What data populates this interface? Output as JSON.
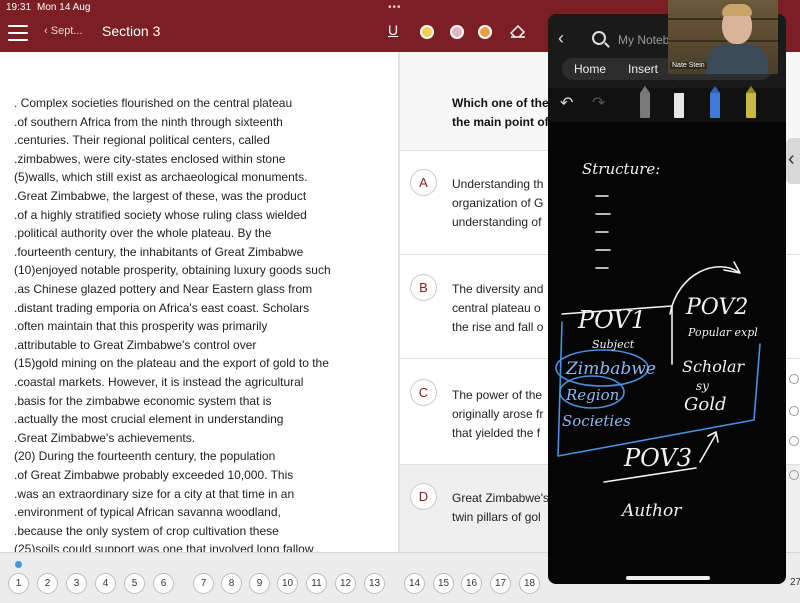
{
  "status": {
    "time": "19:31",
    "date": "Mon 14 Aug",
    "dots": "•••"
  },
  "header": {
    "back_label": "Sept...",
    "title": "Section 3",
    "underline_tool": "U"
  },
  "passage": {
    "lines": [
      ".     Complex societies flourished on the central plateau",
      ".of southern Africa from the ninth through sixteenth",
      ".centuries. Their regional political centers, called",
      ".zimbabwes, were city-states enclosed within stone",
      "(5)walls, which still exist as archaeological monuments.",
      ".Great Zimbabwe, the largest of these, was the product",
      ".of a highly stratified society whose ruling class wielded",
      ".political authority over the whole plateau. By the",
      ".fourteenth century, the inhabitants of Great Zimbabwe",
      "(10)enjoyed notable prosperity, obtaining luxury goods such",
      ".as Chinese glazed pottery and Near Eastern glass from",
      ".distant trading emporia on Africa's east coast. Scholars",
      ".often maintain that this prosperity was primarily",
      ".attributable to Great Zimbabwe's control over",
      "(15)gold mining on the plateau and the export of gold to the",
      ".coastal markets. However, it is instead the agricultural",
      ".basis for the zimbabwe economic system that is",
      ".actually the most crucial element in understanding",
      ".Great Zimbabwe's achievements.",
      "(20)      During the fourteenth century, the population",
      ".of Great Zimbabwe probably exceeded 10,000. This",
      ".was an extraordinary size for a city at that time in an",
      ".environment of typical African savanna woodland,",
      ".because the only system of crop cultivation these",
      "(25)soils could support was one that involved long fallow"
    ]
  },
  "question": {
    "prompt_lines": [
      "Which one of the",
      "the main point of"
    ],
    "choices": [
      {
        "letter": "A",
        "lines": [
          "Understanding th",
          "organization of G",
          "understanding of"
        ]
      },
      {
        "letter": "B",
        "lines": [
          "The diversity and",
          "central plateau o",
          "the rise and fall o"
        ]
      },
      {
        "letter": "C",
        "lines": [
          "The power of the",
          "originally arose fr",
          "that yielded the f"
        ]
      },
      {
        "letter": "D",
        "lines": [
          "Great Zimbabwe's",
          "twin pillars of gol"
        ]
      }
    ]
  },
  "nav": {
    "numbers": [
      "1",
      "2",
      "3",
      "4",
      "5",
      "6",
      "7",
      "8",
      "9",
      "10",
      "11",
      "12",
      "13",
      "14",
      "15",
      "16",
      "17",
      "18"
    ],
    "overflow": "27"
  },
  "notebook": {
    "title": "My Notebo",
    "tabs": {
      "home": "Home",
      "insert": "Insert"
    },
    "handwriting": {
      "structure": "Structure:",
      "pov1": "POV1",
      "pov2": "POV2",
      "pov3": "POV3",
      "subject": "Subject",
      "zimbabwe": "Zimbabwe",
      "region": "Region",
      "societies": "Societies",
      "popular_expl": "Popular expl",
      "scholar": "Scholar",
      "sy": "sy",
      "gold": "Gold",
      "author": "Author"
    }
  },
  "video": {
    "name": "Nate Stein"
  },
  "colors": {
    "brand": "#7b1f24",
    "ink": "#ffffff",
    "annotation": "#4a8fe0",
    "link_blue": "#3b99e6"
  }
}
